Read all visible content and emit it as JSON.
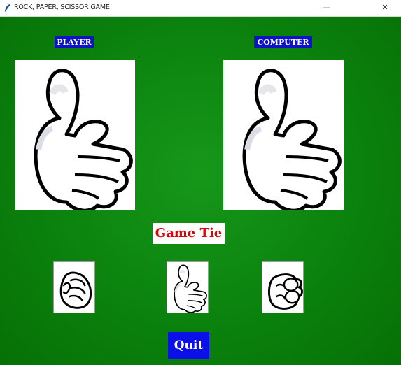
{
  "window": {
    "title": "ROCK, PAPER, SCISSOR GAME",
    "minimize_glyph": "—",
    "close_glyph": "✕"
  },
  "player": {
    "label": "PLAYER",
    "choice_icon": "open-hand-icon"
  },
  "computer": {
    "label": "COMPUTER",
    "choice_icon": "open-hand-icon"
  },
  "result": {
    "text": "Game Tie",
    "color": "#e00000"
  },
  "choices": [
    {
      "name": "rock",
      "icon": "fist-icon"
    },
    {
      "name": "paper",
      "icon": "open-hand-icon"
    },
    {
      "name": "scissor",
      "icon": "scissors-hand-icon"
    }
  ],
  "quit": {
    "label": "Quit"
  },
  "colors": {
    "background": "#0a7a0a",
    "label_bg": "#0e12c8",
    "button_bg": "#0c10e8"
  }
}
